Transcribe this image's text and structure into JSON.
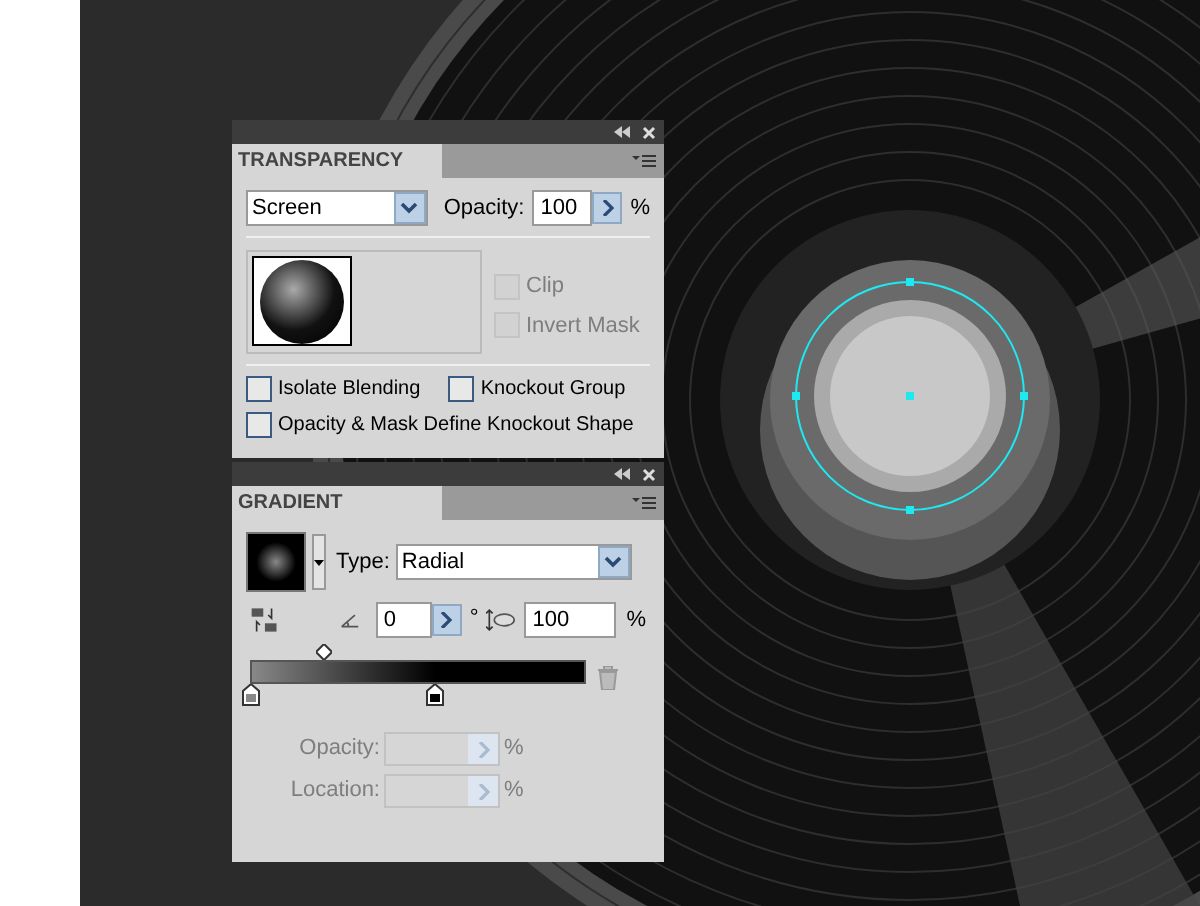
{
  "transparency": {
    "title": "TRANSPARENCY",
    "blend_mode": "Screen",
    "opacity_label": "Opacity:",
    "opacity": "100",
    "opacity_unit": "%",
    "mask_options": [
      {
        "label": "Clip",
        "checked": false,
        "disabled": true
      },
      {
        "label": "Invert Mask",
        "checked": false,
        "disabled": true
      }
    ],
    "options": [
      {
        "label": "Isolate Blending",
        "checked": false
      },
      {
        "label": "Knockout Group",
        "checked": false
      },
      {
        "label": "Opacity & Mask Define Knockout Shape",
        "checked": false
      }
    ]
  },
  "gradient": {
    "title": "GRADIENT",
    "type_label": "Type:",
    "type": "Radial",
    "angle": "0",
    "angle_unit": "°",
    "aspect": "100",
    "aspect_unit": "%",
    "stops": [
      {
        "level": 0
      },
      {
        "level": 0.55
      }
    ],
    "stop_fields": [
      {
        "label": "Opacity:",
        "unit": "%",
        "disabled": true
      },
      {
        "label": "Location:",
        "unit": "%",
        "disabled": true
      }
    ]
  }
}
